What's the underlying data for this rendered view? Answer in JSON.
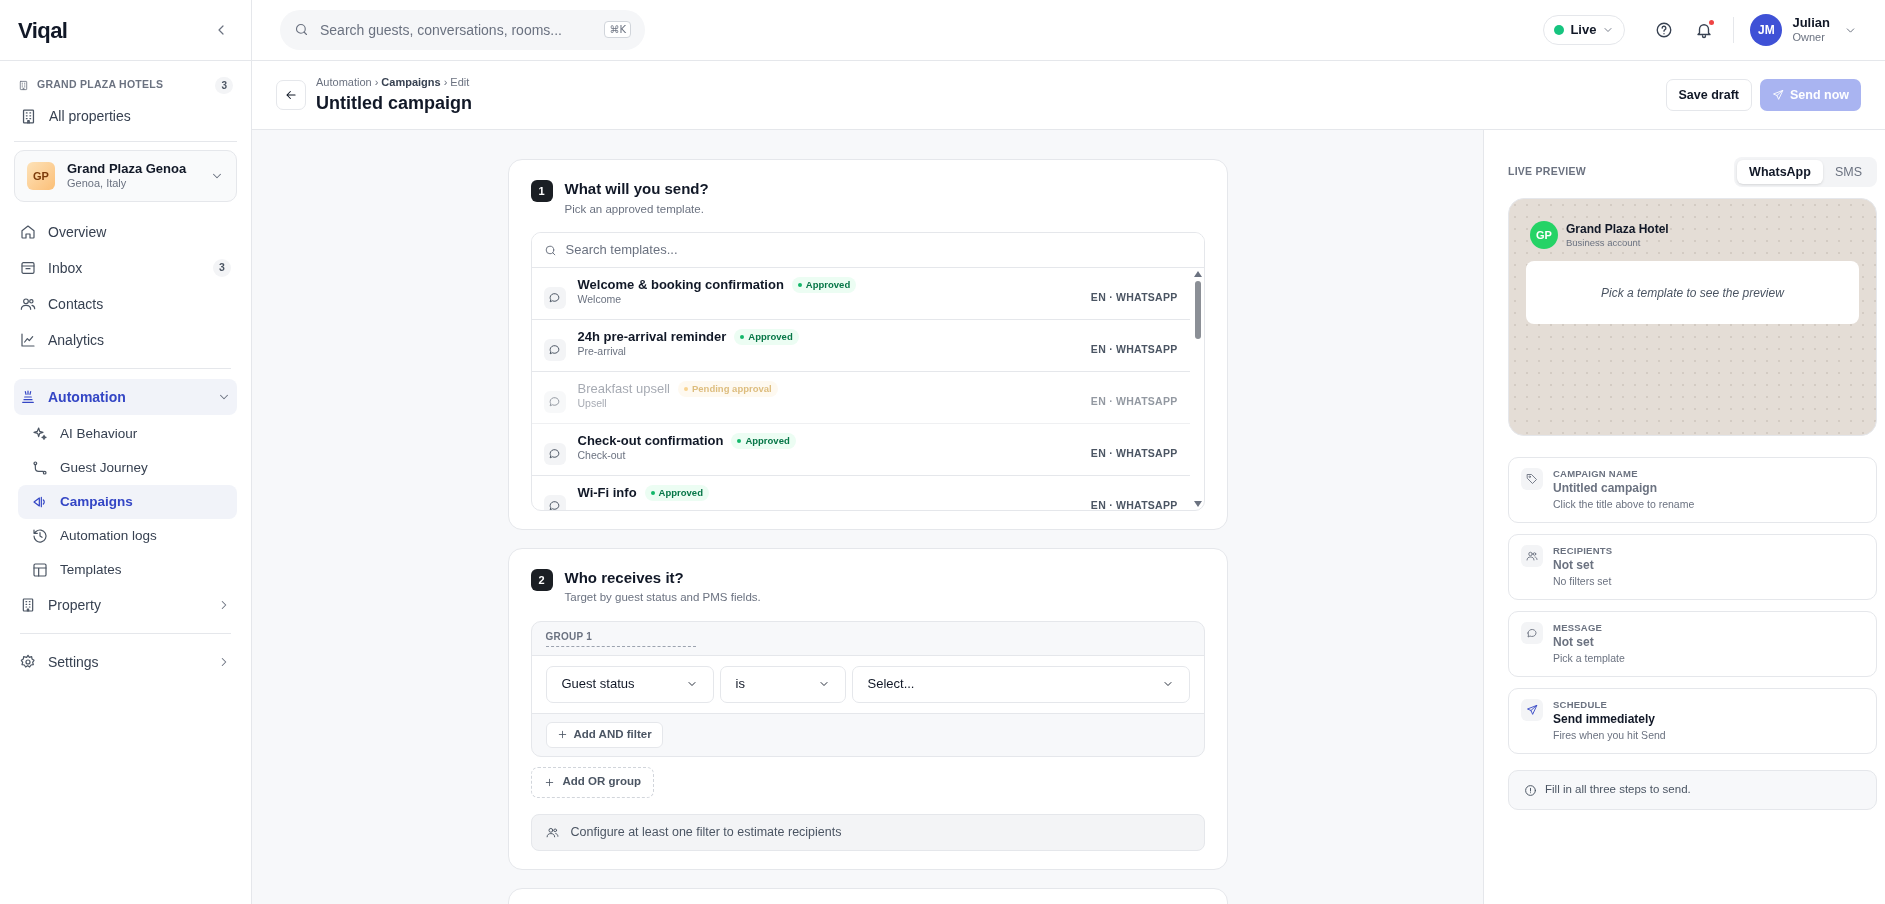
{
  "sidebar": {
    "logo": "Viqal",
    "org": {
      "label": "GRAND PLAZA HOTELS",
      "count": "3"
    },
    "all_properties": "All properties",
    "property": {
      "initials": "GP",
      "name": "Grand Plaza Genoa",
      "location": "Genoa, Italy"
    },
    "nav": [
      {
        "label": "Overview",
        "kind": "home",
        "selected": false
      },
      {
        "label": "Inbox",
        "kind": "inbox",
        "selected": false,
        "badge": "3"
      },
      {
        "label": "Contacts",
        "kind": "users",
        "selected": false
      },
      {
        "label": "Analytics",
        "kind": "chart",
        "selected": false
      }
    ],
    "nav2": [
      {
        "label": "Automation",
        "kind": "automation",
        "selected": true,
        "expanded": true,
        "children": [
          {
            "label": "AI Behaviour",
            "kind": "sparkle",
            "selected": false
          },
          {
            "label": "Guest Journey",
            "kind": "route",
            "selected": false
          },
          {
            "label": "Campaigns",
            "kind": "megaphone",
            "selected": true
          },
          {
            "label": "Automation logs",
            "kind": "history",
            "selected": false
          },
          {
            "label": "Templates",
            "kind": "layout",
            "selected": false
          }
        ]
      },
      {
        "label": "Property",
        "kind": "building",
        "selected": false,
        "expanded": false
      }
    ],
    "nav3": [
      {
        "label": "Settings",
        "kind": "gear",
        "selected": false,
        "expanded": false
      }
    ]
  },
  "topbar": {
    "search": {
      "placeholder": "Search guests, conversations, rooms...",
      "shortcut": "⌘K"
    },
    "live": {
      "label": "Live",
      "on": true
    },
    "notifications": {
      "unread": true
    },
    "user": {
      "initials": "JM",
      "name": "Julian",
      "role": "Owner"
    }
  },
  "header": {
    "breadcrumb": [
      "Automation",
      "Campaigns",
      "Edit"
    ],
    "separator": "›",
    "title": "Untitled campaign",
    "buttons": [
      {
        "label": "Save draft",
        "kind": "secondary",
        "disabled": false
      },
      {
        "label": "Send now",
        "kind": "primary",
        "disabled": true
      }
    ]
  },
  "step1": {
    "number": "1",
    "title": "What will you send?",
    "subtitle": "Pick an approved template.",
    "search": {
      "placeholder": "Search templates..."
    },
    "templates": [
      {
        "name": "Welcome & booking confirmation",
        "category": "Welcome",
        "status": {
          "label": "Approved",
          "kind": "approved"
        },
        "meta": "EN · WHATSAPP",
        "disabled": false
      },
      {
        "name": "24h pre-arrival reminder",
        "category": "Pre-arrival",
        "status": {
          "label": "Approved",
          "kind": "approved"
        },
        "meta": "EN · WHATSAPP",
        "disabled": false
      },
      {
        "name": "Breakfast upsell",
        "category": "Upsell",
        "status": {
          "label": "Pending approval",
          "kind": "pending"
        },
        "meta": "EN · WHATSAPP",
        "disabled": true
      },
      {
        "name": "Check-out confirmation",
        "category": "Check-out",
        "status": {
          "label": "Approved",
          "kind": "approved"
        },
        "meta": "EN · WHATSAPP",
        "disabled": false
      },
      {
        "name": "Wi-Fi info",
        "status": {
          "label": "Approved",
          "kind": "approved"
        },
        "meta": "EN · WHATSAPP",
        "disabled": false
      }
    ]
  },
  "step2": {
    "number": "2",
    "title": "Who receives it?",
    "subtitle": "Target by guest status and PMS fields.",
    "groups": [
      {
        "label": "GROUP 1",
        "filters": [
          {
            "field": "Guest status",
            "operator": "is",
            "value": "Select..."
          }
        ],
        "add_filter": "Add AND filter"
      }
    ],
    "add_group": "Add OR group",
    "estimate": "Configure at least one filter to estimate recipients"
  },
  "preview": {
    "label": "LIVE PREVIEW",
    "channels": [
      {
        "label": "WhatsApp",
        "selected": true
      },
      {
        "label": "SMS",
        "selected": false
      }
    ],
    "account": {
      "initials": "GP",
      "name": "Grand Plaza Hotel",
      "type": "Business account"
    },
    "placeholder": "Pick a template to see the preview"
  },
  "summary": [
    {
      "kind": "tag",
      "label": "CAMPAIGN NAME",
      "value": "Untitled campaign",
      "hint": "Click the title above to rename",
      "set": false
    },
    {
      "kind": "users",
      "label": "RECIPIENTS",
      "value": "Not set",
      "hint": "No filters set",
      "set": false
    },
    {
      "kind": "message",
      "label": "MESSAGE",
      "value": "Not set",
      "hint": "Pick a template",
      "set": false
    },
    {
      "kind": "send",
      "label": "SCHEDULE",
      "value": "Send immediately",
      "hint": "Fires when you hit Send",
      "set": true
    }
  ],
  "notice": "Fill in all three steps to send."
}
